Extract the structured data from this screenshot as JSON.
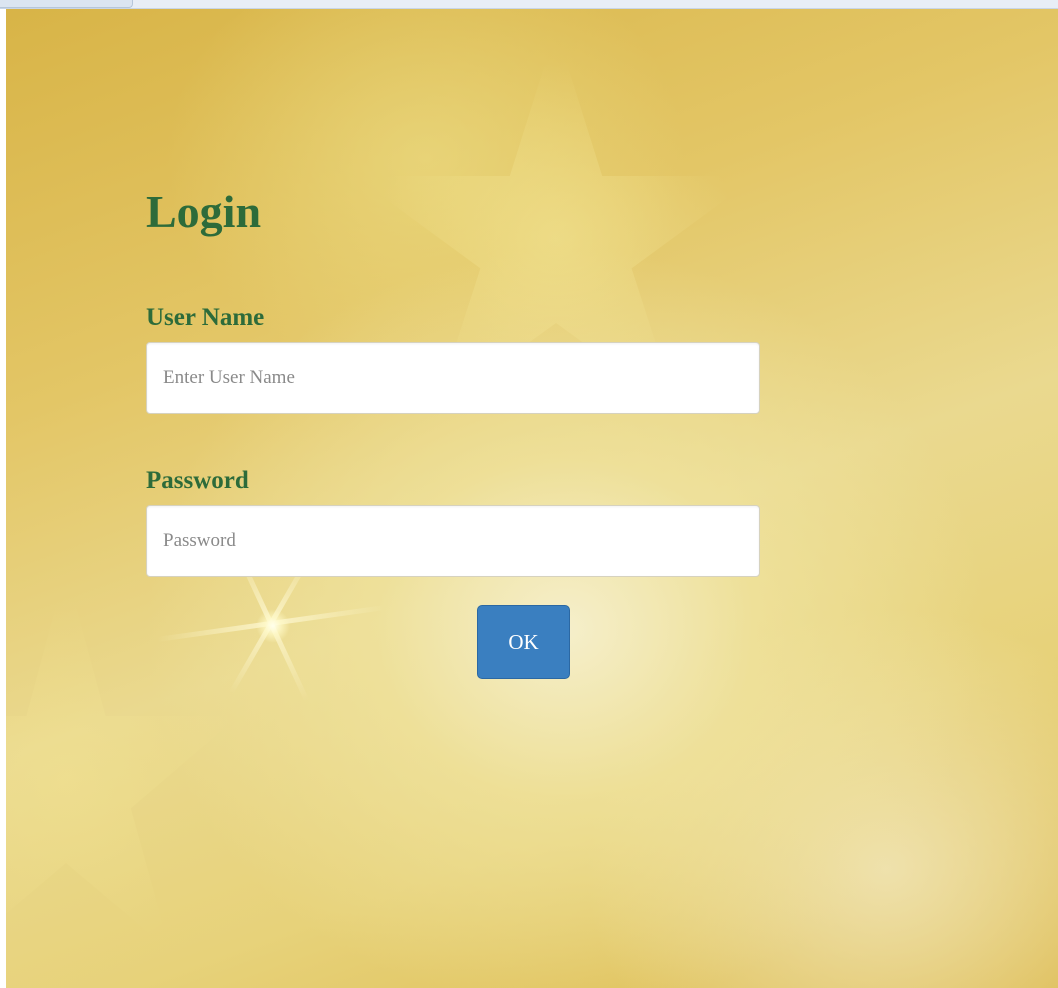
{
  "login": {
    "title": "Login",
    "username": {
      "label": "User Name",
      "placeholder": "Enter User Name",
      "value": ""
    },
    "password": {
      "label": "Password",
      "placeholder": "Password",
      "value": ""
    },
    "submit_label": "OK"
  },
  "colors": {
    "heading": "#2d6b3a",
    "button": "#3a7fc0",
    "background": "#e3c666"
  }
}
